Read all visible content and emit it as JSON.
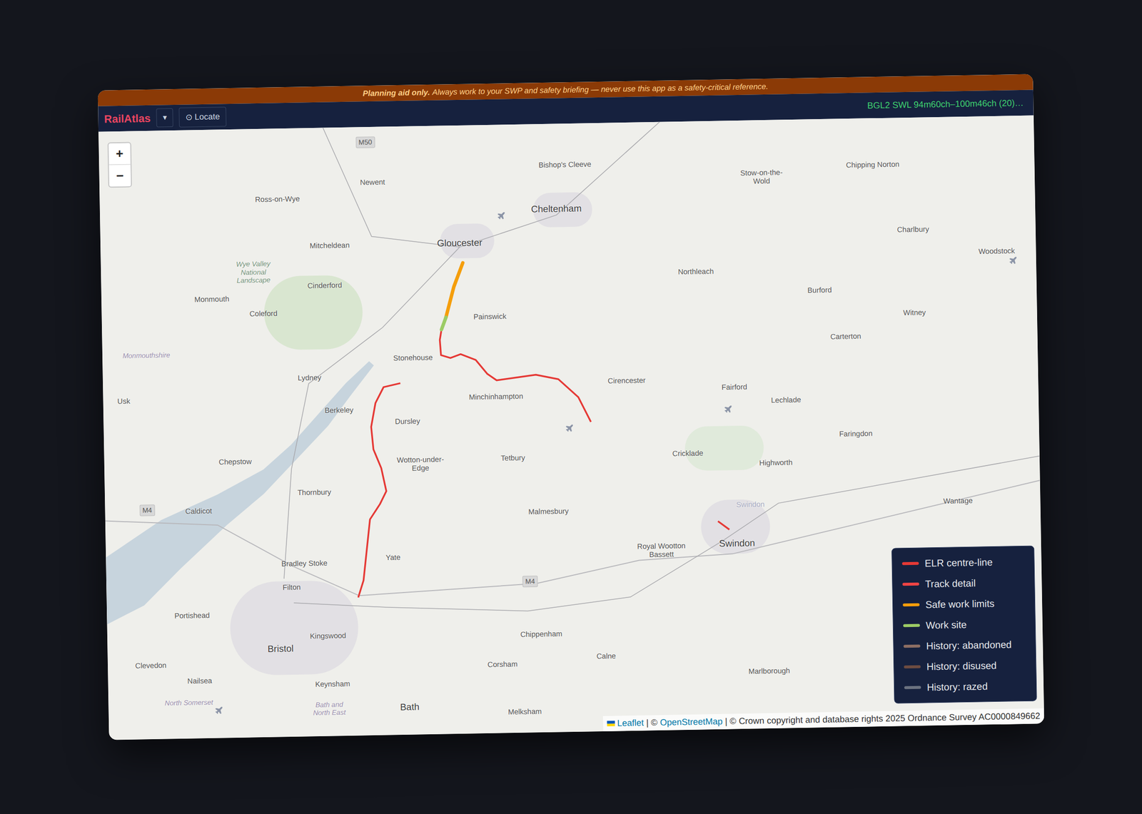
{
  "banner": {
    "bold": "Planning aid only.",
    "text": "Always work to your SWP and safety briefing — never use this app as a safety-critical reference."
  },
  "toolbar": {
    "brand": "RailAtlas",
    "menu": "▾",
    "locate": "⊙ Locate",
    "status": "BGL2 SWL 94m60ch–100m46ch (20)…"
  },
  "zoom": [
    "+",
    "−"
  ],
  "map": {
    "labels": [
      {
        "name": "Bishop's Cleeve",
        "kind": "town"
      },
      {
        "name": "Newent",
        "kind": "town"
      },
      {
        "name": "Ross-on-Wye",
        "kind": "town"
      },
      {
        "name": "Stow-on-the-Wold",
        "kind": "town"
      },
      {
        "name": "Chipping Norton",
        "kind": "town"
      },
      {
        "name": "Cheltenham",
        "kind": "city"
      },
      {
        "name": "Gloucester",
        "kind": "city"
      },
      {
        "name": "Mitcheldean",
        "kind": "town"
      },
      {
        "name": "Charlbury",
        "kind": "town"
      },
      {
        "name": "Woodstock",
        "kind": "town"
      },
      {
        "name": "Wye Valley National Landscape",
        "kind": "park"
      },
      {
        "name": "Cinderford",
        "kind": "town"
      },
      {
        "name": "Monmouth",
        "kind": "town"
      },
      {
        "name": "Northleach",
        "kind": "town"
      },
      {
        "name": "Coleford",
        "kind": "town"
      },
      {
        "name": "Burford",
        "kind": "town"
      },
      {
        "name": "Painswick",
        "kind": "town"
      },
      {
        "name": "Witney",
        "kind": "town"
      },
      {
        "name": "Monmouthshire",
        "kind": "region"
      },
      {
        "name": "Carterton",
        "kind": "town"
      },
      {
        "name": "Stonehouse",
        "kind": "town"
      },
      {
        "name": "Lydney",
        "kind": "town"
      },
      {
        "name": "Usk",
        "kind": "town"
      },
      {
        "name": "Cirencester",
        "kind": "town"
      },
      {
        "name": "Minchinhampton",
        "kind": "town"
      },
      {
        "name": "Berkeley",
        "kind": "town"
      },
      {
        "name": "Fairford",
        "kind": "town"
      },
      {
        "name": "Lechlade",
        "kind": "town"
      },
      {
        "name": "Dursley",
        "kind": "town"
      },
      {
        "name": "Chepstow",
        "kind": "town"
      },
      {
        "name": "Wotton-under-Edge",
        "kind": "town"
      },
      {
        "name": "Faringdon",
        "kind": "town"
      },
      {
        "name": "Tetbury",
        "kind": "town"
      },
      {
        "name": "Cricklade",
        "kind": "town"
      },
      {
        "name": "Highworth",
        "kind": "town"
      },
      {
        "name": "Thornbury",
        "kind": "town"
      },
      {
        "name": "Caldicot",
        "kind": "town"
      },
      {
        "name": "Malmesbury",
        "kind": "town"
      },
      {
        "name": "Wantage",
        "kind": "town"
      },
      {
        "name": "Bradley Stoke",
        "kind": "town"
      },
      {
        "name": "Yate",
        "kind": "town"
      },
      {
        "name": "Royal Wootton Bassett",
        "kind": "town"
      },
      {
        "name": "Swindon",
        "kind": "faded"
      },
      {
        "name": "Swindon",
        "kind": "city"
      },
      {
        "name": "Filton",
        "kind": "town"
      },
      {
        "name": "Portishead",
        "kind": "town"
      },
      {
        "name": "Kingswood",
        "kind": "town"
      },
      {
        "name": "Bristol",
        "kind": "city"
      },
      {
        "name": "Chippenham",
        "kind": "town"
      },
      {
        "name": "Clevedon",
        "kind": "town"
      },
      {
        "name": "Nailsea",
        "kind": "town"
      },
      {
        "name": "Keynsham",
        "kind": "town"
      },
      {
        "name": "Corsham",
        "kind": "town"
      },
      {
        "name": "Calne",
        "kind": "town"
      },
      {
        "name": "North Somerset",
        "kind": "region"
      },
      {
        "name": "Marlborough",
        "kind": "town"
      },
      {
        "name": "Bath",
        "kind": "city"
      },
      {
        "name": "Bath and North East",
        "kind": "region"
      },
      {
        "name": "Melksham",
        "kind": "town"
      }
    ],
    "roads": [
      "M50",
      "M4",
      "M4"
    ]
  },
  "legend": [
    {
      "label": "ELR centre-line",
      "color": "#e53935"
    },
    {
      "label": "Track detail",
      "color": "#ef4444"
    },
    {
      "label": "Safe work limits",
      "color": "#f59e0b"
    },
    {
      "label": "Work site",
      "color": "#9ccc65"
    },
    {
      "label": "History: abandoned",
      "color": "#8d6e63"
    },
    {
      "label": "History: disused",
      "color": "#6d4c41"
    },
    {
      "label": "History: razed",
      "color": "#6b7280"
    }
  ],
  "attribution": {
    "leaflet": "Leaflet",
    "sep": "| ©",
    "osm": "OpenStreetMap",
    "rest": "| © Crown copyright and database rights 2025 Ordnance Survey AC0000849662"
  }
}
